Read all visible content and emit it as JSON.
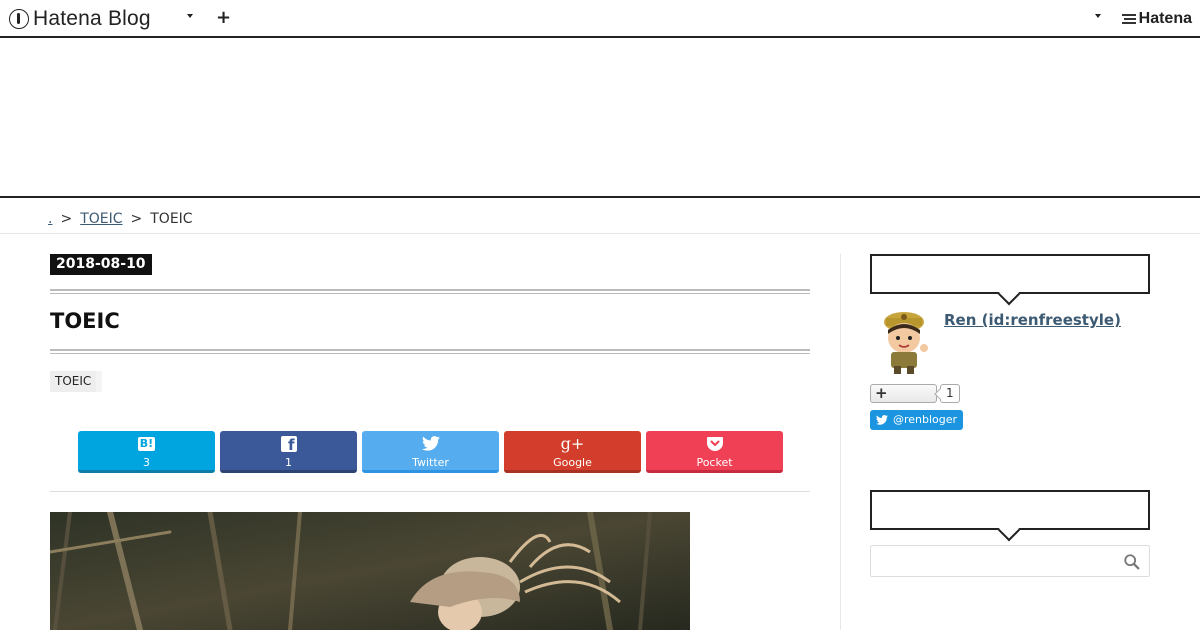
{
  "topbar": {
    "logo_text": "Hatena Blog",
    "plus_label": "+",
    "brand_text": "Hatena"
  },
  "breadcrumb": {
    "home_label": ".",
    "separator": ">",
    "category_label": "TOEIC",
    "current_label": "TOEIC"
  },
  "entry": {
    "date": "2018-08-10",
    "title": "TOEIC",
    "category_tag": "TOEIC"
  },
  "share": {
    "buttons": [
      {
        "service": "hatena-bookmark",
        "icon": "B!",
        "label": "3",
        "color": "#00a4de"
      },
      {
        "service": "facebook",
        "icon": "f",
        "label": "1",
        "color": "#3b5998"
      },
      {
        "service": "twitter",
        "icon": "twitter-bird",
        "label": "Twitter",
        "color": "#55acee"
      },
      {
        "service": "google-plus",
        "icon": "g+",
        "label": "Google",
        "color": "#d23e2b"
      },
      {
        "service": "pocket",
        "icon": "pocket",
        "label": "Pocket",
        "color": "#ef4056"
      }
    ]
  },
  "sidebar": {
    "profile": {
      "name": "Ren (id:renfreestyle)",
      "follow_count": "1",
      "twitter_handle": "@renbloger"
    }
  },
  "colors": {
    "link": "#3d5a73",
    "twitter_blue": "#1b95e0"
  }
}
